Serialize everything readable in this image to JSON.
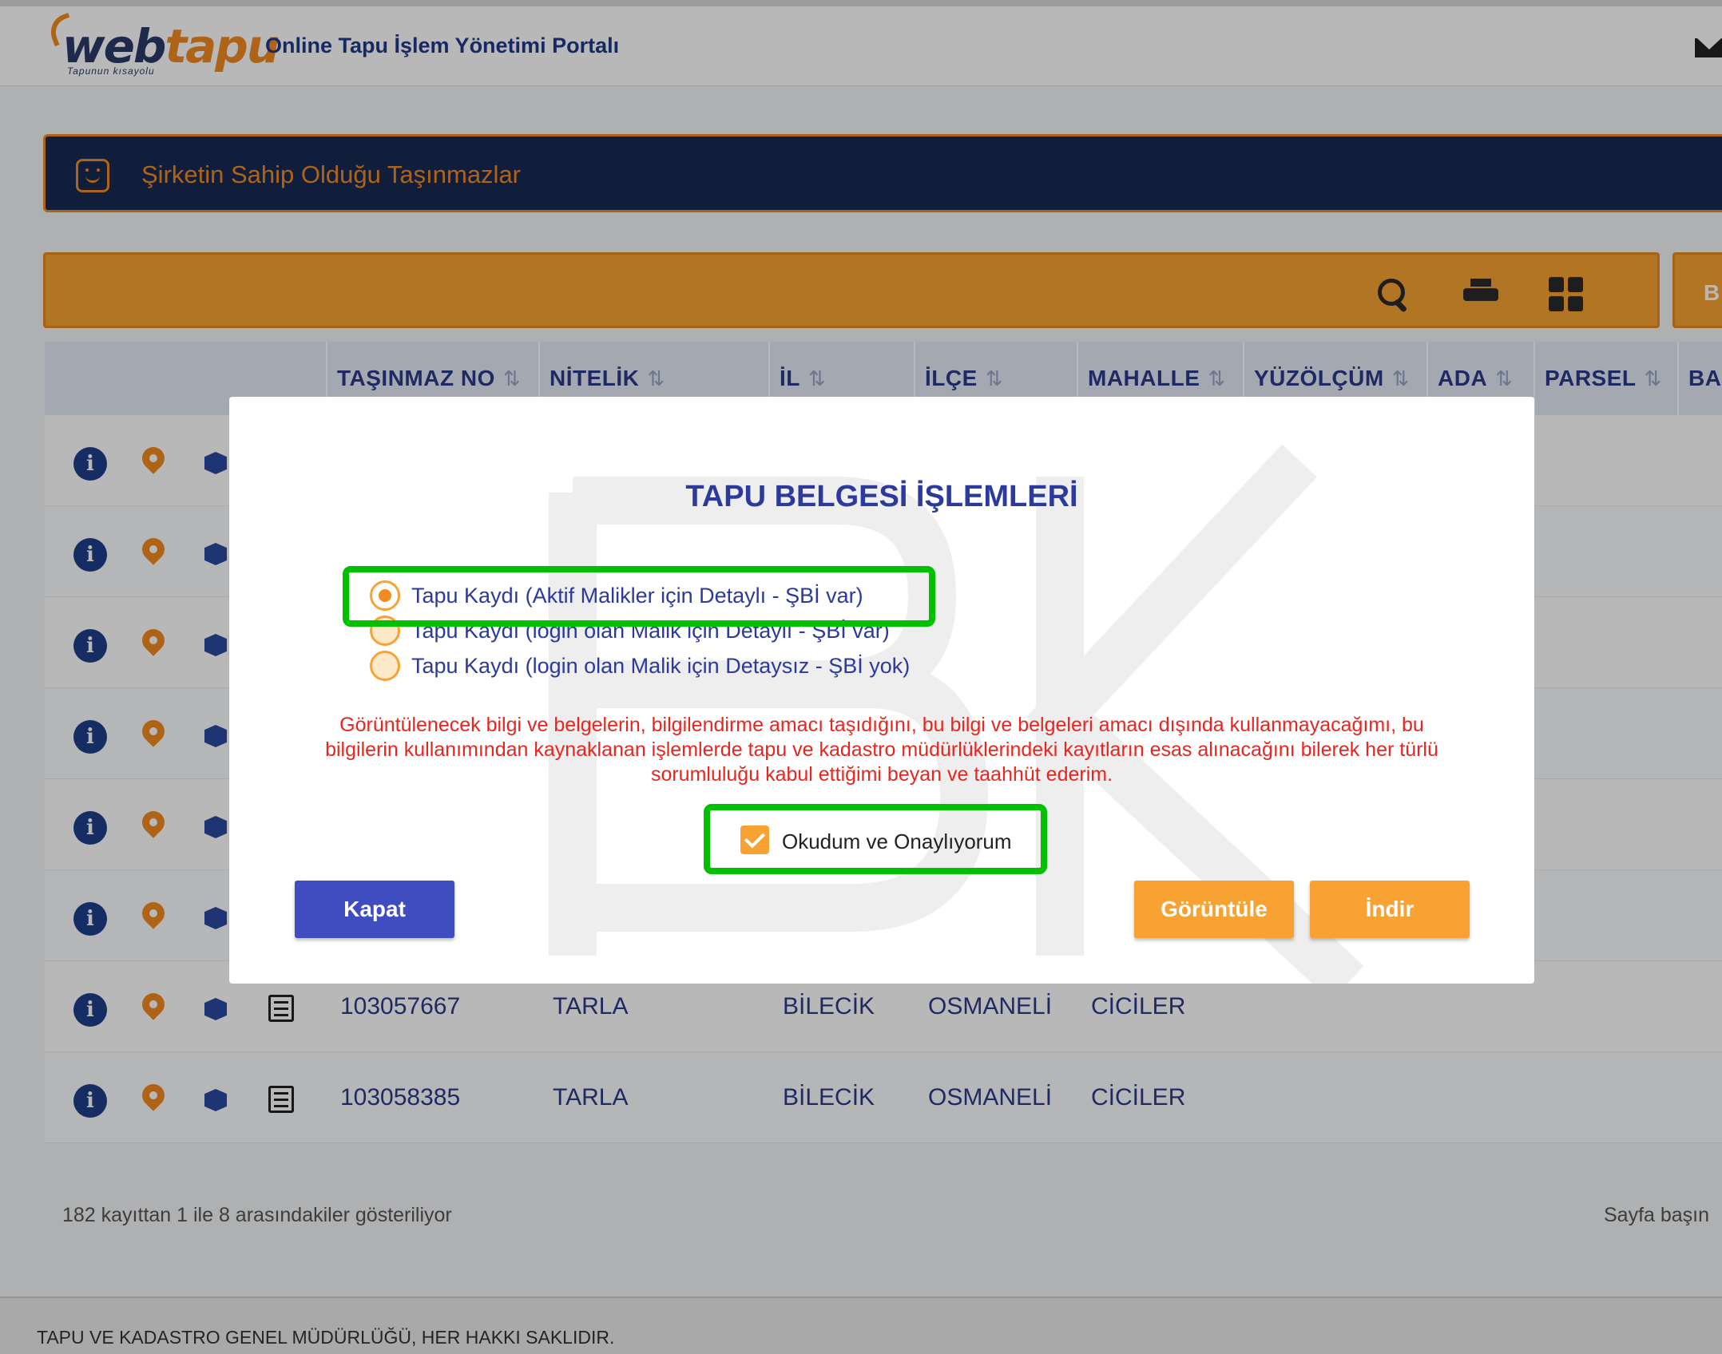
{
  "header": {
    "logo_main_a": "web",
    "logo_main_b": "tapu",
    "logo_sub": "Tapunun kısayolu",
    "portal_title": "Online Tapu İşlem Yönetimi Portalı"
  },
  "panel": {
    "title": "Şirketin Sahip Olduğu Taşınmazlar",
    "right_button_label": "B"
  },
  "table": {
    "sort_glyph": "⇅",
    "columns": [
      "TAŞINMAZ NO",
      "NİTELİK",
      "İL",
      "İLÇE",
      "MAHALLE",
      "YÜZÖLÇÜM",
      "ADA",
      "PARSEL",
      "BAĞ"
    ],
    "rows": [
      {
        "no": "",
        "nitelik": "",
        "il": "",
        "ilce": "",
        "mahalle": ""
      },
      {
        "no": "",
        "nitelik": "",
        "il": "",
        "ilce": "",
        "mahalle": ""
      },
      {
        "no": "",
        "nitelik": "",
        "il": "",
        "ilce": "",
        "mahalle": ""
      },
      {
        "no": "",
        "nitelik": "",
        "il": "",
        "ilce": "",
        "mahalle": ""
      },
      {
        "no": "",
        "nitelik": "",
        "il": "",
        "ilce": "",
        "mahalle": ""
      },
      {
        "no": "",
        "nitelik": "",
        "il": "",
        "ilce": "",
        "mahalle": ""
      },
      {
        "no": "103057667",
        "nitelik": "TARLA",
        "il": "BİLECİK",
        "ilce": "OSMANELİ",
        "mahalle": "CİCİLER"
      },
      {
        "no": "103058385",
        "nitelik": "TARLA",
        "il": "BİLECİK",
        "ilce": "OSMANELİ",
        "mahalle": "CİCİLER"
      }
    ],
    "info_glyph": "i"
  },
  "footer": {
    "records_info": "182 kayıttan 1 ile 8 arasındakiler gösteriliyor",
    "page_label": "Sayfa başın",
    "copyright": "TAPU VE KADASTRO GENEL MÜDÜRLÜĞÜ, HER HAKKI SAKLIDIR."
  },
  "modal": {
    "title": "TAPU BELGESİ İŞLEMLERİ",
    "options": [
      {
        "label": "Tapu Kaydı (Aktif Malikler için Detaylı - ŞBİ var)",
        "checked": true
      },
      {
        "label": "Tapu Kaydı (login olan Malik için Detaylı - ŞBİ var)",
        "checked": false
      },
      {
        "label": "Tapu Kaydı (login olan Malik için Detaysız - ŞBİ yok)",
        "checked": false
      }
    ],
    "disclaimer": "Görüntülenecek bilgi ve belgelerin, bilgilendirme amacı taşıdığını, bu bilgi ve belgeleri amacı dışında kullanmayacağımı, bu bilgilerin kullanımından kaynaklanan işlemlerde tapu ve kadastro müdürlüklerindeki kayıtların esas alınacağını bilerek her türlü sorumluluğu kabul ettiğimi beyan ve taahhüt ederim.",
    "consent_label": "Okudum ve Onaylıyorum",
    "consent_checked": true,
    "buttons": {
      "close": "Kapat",
      "view": "Görüntüle",
      "download": "İndir"
    }
  },
  "colors": {
    "brand_orange": "#f7a233",
    "brand_navy": "#172a52",
    "highlight_green": "#00c000",
    "warning_red": "#e8261f"
  },
  "icons": [
    "envelope-icon",
    "smile-icon",
    "search-icon",
    "print-icon",
    "grid-icon",
    "info-icon",
    "location-pin-icon",
    "cube-icon",
    "list-icon"
  ]
}
